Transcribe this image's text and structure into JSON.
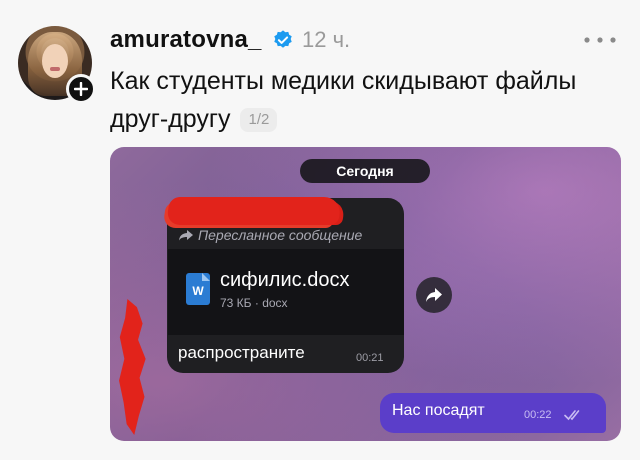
{
  "post": {
    "username": "amuratovna_",
    "time": "12 ч.",
    "caption": "Как студенты медики скидывают файлы друг-другу",
    "pager": "1/2"
  },
  "chat": {
    "date_label": "Сегодня",
    "forward_label": "Пересланное сообщение",
    "file": {
      "name": "сифилис.docx",
      "meta": "73 КБ · docx",
      "icon_letter": "W"
    },
    "incoming": {
      "text": "распространите",
      "time": "00:21"
    },
    "outgoing": {
      "text": "Нас посадят",
      "time": "00:22"
    }
  },
  "icons": {
    "avatar_badge": "plus-icon",
    "verified": "verified-badge-icon",
    "more": "more-dots-icon",
    "forward": "forward-arrow-icon",
    "share": "share-arrow-icon",
    "read": "double-check-icon"
  },
  "colors": {
    "verified_blue": "#1d9bf0",
    "outgoing_bubble": "#5b3ec9",
    "incoming_bubble": "#1f1f22",
    "redaction": "#e2231b"
  }
}
